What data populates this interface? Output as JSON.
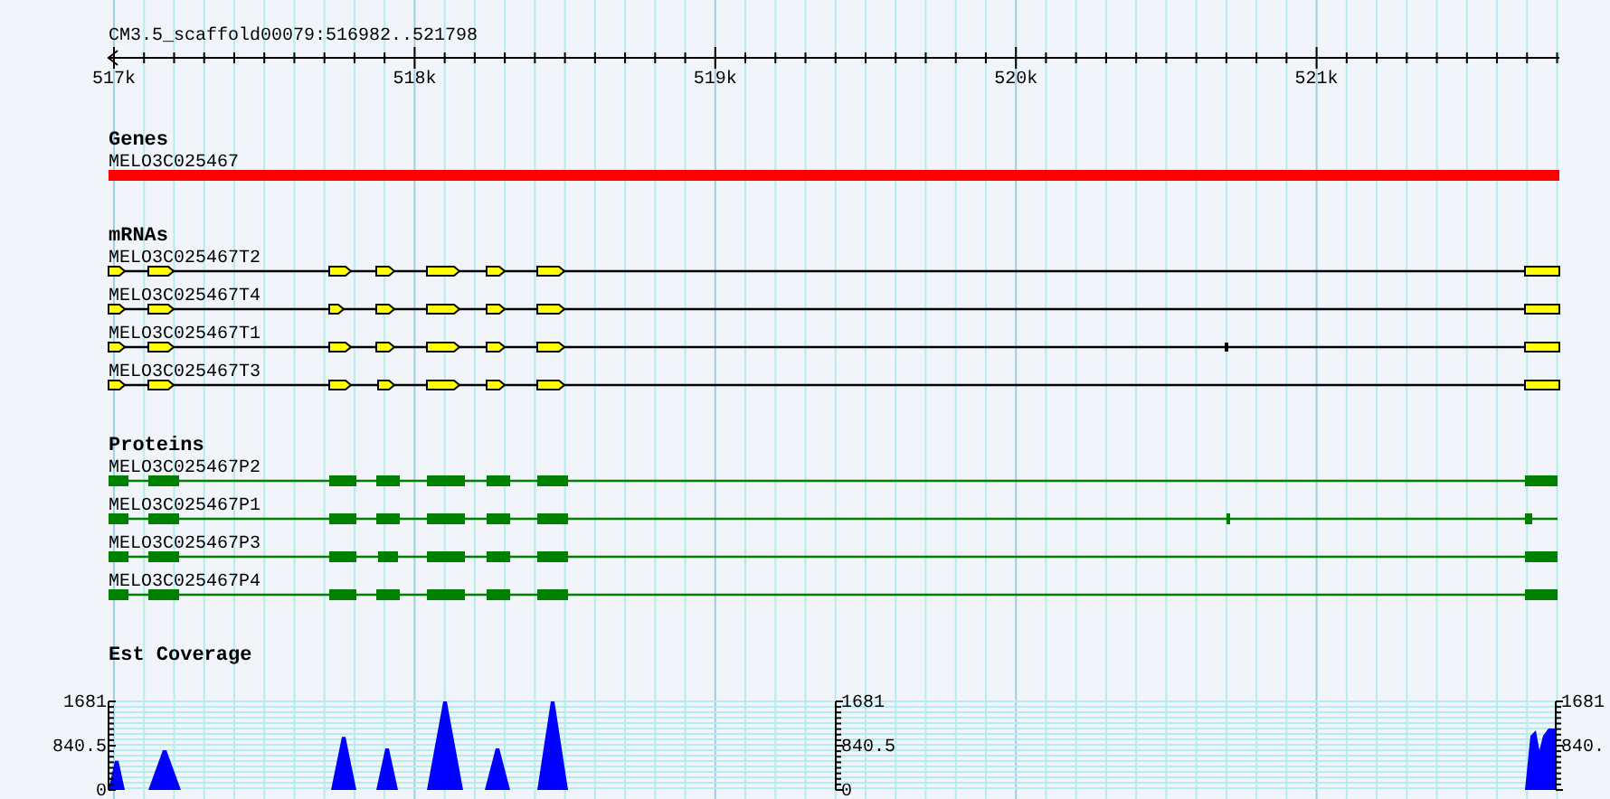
{
  "title": "CM3.5_scaffold00079:516982..521798",
  "ruler": {
    "ticks": [
      "517k",
      "518k",
      "519k",
      "520k",
      "521k"
    ]
  },
  "tracks": [
    {
      "kind": "gene",
      "title": "Genes",
      "features": [
        {
          "name": "MELO3C025467"
        }
      ]
    },
    {
      "kind": "mrna",
      "title": "mRNAs",
      "features": [
        {
          "name": "MELO3C025467T2"
        },
        {
          "name": "MELO3C025467T4"
        },
        {
          "name": "MELO3C025467T1"
        },
        {
          "name": "MELO3C025467T3"
        }
      ]
    },
    {
      "kind": "protein",
      "title": "Proteins",
      "features": [
        {
          "name": "MELO3C025467P2"
        },
        {
          "name": "MELO3C025467P1"
        },
        {
          "name": "MELO3C025467P3"
        },
        {
          "name": "MELO3C025467P4"
        }
      ]
    },
    {
      "kind": "coverage",
      "title": "Est Coverage",
      "axes": [
        {
          "labels": [
            "1681",
            "840.5",
            "0"
          ]
        },
        {
          "labels": [
            "1681",
            "840.5",
            "0"
          ]
        },
        {
          "labels": [
            "1681",
            "840."
          ]
        }
      ]
    }
  ]
}
